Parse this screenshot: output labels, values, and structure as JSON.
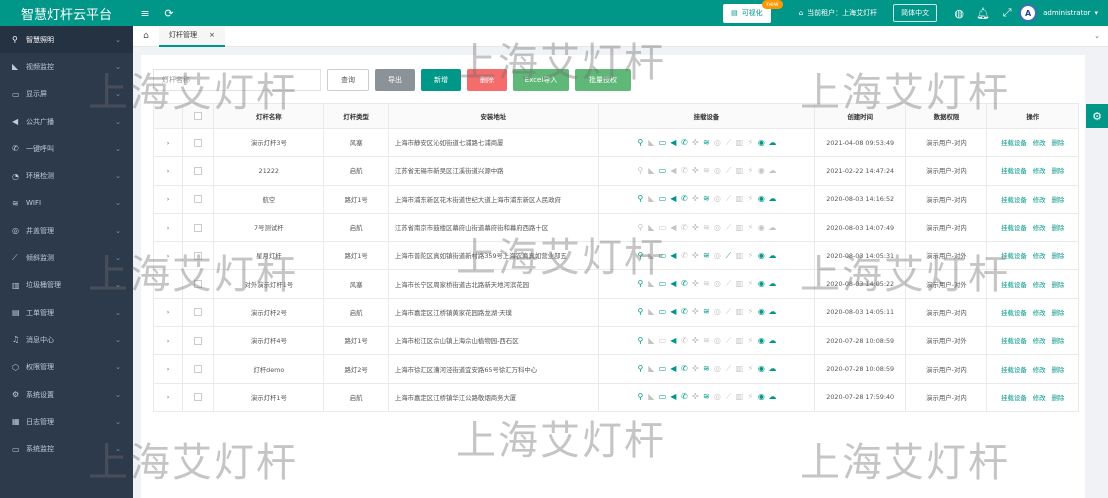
{
  "app_title": "智慧灯杆云平台",
  "header": {
    "menu_icon": "hamburger-icon",
    "refresh_icon": "refresh-icon",
    "dashboard_label": "可视化",
    "new_badge": "new",
    "tenant_label": "当前租户：上海艾灯杆",
    "lang_label": "简体中文",
    "notification_count": "",
    "avatar_text": "A",
    "user_name": "administrator"
  },
  "sidebar": {
    "items": [
      {
        "label": "智慧照明",
        "icon": "lamp-icon",
        "active": true
      },
      {
        "label": "视频监控",
        "icon": "camera-icon"
      },
      {
        "label": "显示屏",
        "icon": "monitor-icon"
      },
      {
        "label": "公共广播",
        "icon": "broadcast-icon"
      },
      {
        "label": "一键呼叫",
        "icon": "phone-icon"
      },
      {
        "label": "环境检测",
        "icon": "environment-icon"
      },
      {
        "label": "WIFI",
        "icon": "wifi-icon"
      },
      {
        "label": "井盖管理",
        "icon": "manhole-icon"
      },
      {
        "label": "倾斜监测",
        "icon": "tilt-icon"
      },
      {
        "label": "垃圾桶管理",
        "icon": "trash-icon"
      },
      {
        "label": "工单管理",
        "icon": "workorder-icon"
      },
      {
        "label": "消息中心",
        "icon": "bell-icon"
      },
      {
        "label": "权限管理",
        "icon": "shield-icon"
      },
      {
        "label": "系统设置",
        "icon": "gear-icon"
      },
      {
        "label": "日志管理",
        "icon": "log-icon"
      },
      {
        "label": "系统监控",
        "icon": "monitor-icon"
      }
    ]
  },
  "tabs": [
    {
      "label": "灯杆管理"
    }
  ],
  "toolbar": {
    "search_placeholder": "灯杆名称",
    "query_label": "查询",
    "export_label": "导出",
    "add_label": "新增",
    "delete_label": "删除",
    "excel_import_label": "Excel导入",
    "batch_permission_label": "批量授权"
  },
  "table": {
    "columns": [
      "灯杆名称",
      "灯杆类型",
      "安装地址",
      "挂载设备",
      "创建时间",
      "数据权限",
      "操作"
    ],
    "row_actions": [
      "挂载设备",
      "修改",
      "删除"
    ],
    "rows": [
      {
        "name": "演示灯杆3号",
        "type": "风塞",
        "address": "上海市静安区沁如街道七浦路七浦商厦",
        "created": "2021-04-08 09:53:49",
        "perm": "演示用户-对内"
      },
      {
        "name": "21222",
        "type": "启航",
        "address": "江苏省无锡市新吴区江溪街道兴源中路",
        "created": "2021-02-22 14:47:24",
        "perm": "演示用户-对内"
      },
      {
        "name": "航空",
        "type": "路灯1号",
        "address": "上海市浦东新区花木街道世纪大道上海市浦东新区人民政府",
        "created": "2020-08-03 14:16:52",
        "perm": "演示用户-对内"
      },
      {
        "name": "7号测试杆",
        "type": "启航",
        "address": "江苏省南京市鼓楼区幕府山街道幕府街和幕府西路十区",
        "created": "2020-08-03 14:07:49",
        "perm": "演示用户-对内"
      },
      {
        "name": "星月灯杆",
        "type": "路灯1号",
        "address": "上海市普陀区真如镇街道新村路359号上海农商真如营业部五",
        "created": "2020-08-03 14:05:31",
        "perm": "演示用户-对外"
      },
      {
        "name": "对外演示灯杆1号",
        "type": "风塞",
        "address": "上海市长宁区周家桥街道古北路新天地河滨花园",
        "created": "2020-08-03 14:05:22",
        "perm": "演示用户-对外"
      },
      {
        "name": "演示灯杆2号",
        "type": "启航",
        "address": "上海市嘉定区江桥镇黄家花园路龙湖·天璞",
        "created": "2020-08-03 14:05:11",
        "perm": "演示用户-对内"
      },
      {
        "name": "演示灯杆4号",
        "type": "路灯1号",
        "address": "上海市松江区佘山镇上海佘山植物园-西石区",
        "created": "2020-07-28 10:08:59",
        "perm": "演示用户-对外"
      },
      {
        "name": "灯杆demo",
        "type": "路灯2号",
        "address": "上海市徐汇区漕河泾街道宜安路65号徐汇万科中心",
        "created": "2020-07-28 10:08:59",
        "perm": "演示用户-对内"
      },
      {
        "name": "演示灯杆1号",
        "type": "启航",
        "address": "上海市嘉定区江桥镇华江公路敬烟商务大厦",
        "created": "2020-07-28 17:59:40",
        "perm": "演示用户-对内"
      }
    ],
    "device_icons": [
      "lamp-icon",
      "camera-icon",
      "screen-icon",
      "broadcast-icon",
      "phone-icon",
      "sensor-icon",
      "wifi-icon",
      "manhole-icon",
      "tilt-icon",
      "trash-icon",
      "charger-icon",
      "radar-icon",
      "cloud-icon"
    ]
  },
  "watermark": "上海艾灯杆",
  "colors": {
    "primary": "#009688",
    "gray_btn": "#8c9398",
    "red_btn": "#f56c6c",
    "green_btn": "#5fb878",
    "sidebar_bg": "#2d3a4b",
    "device_active": "#009688",
    "device_inactive": "#c4c4c4"
  }
}
